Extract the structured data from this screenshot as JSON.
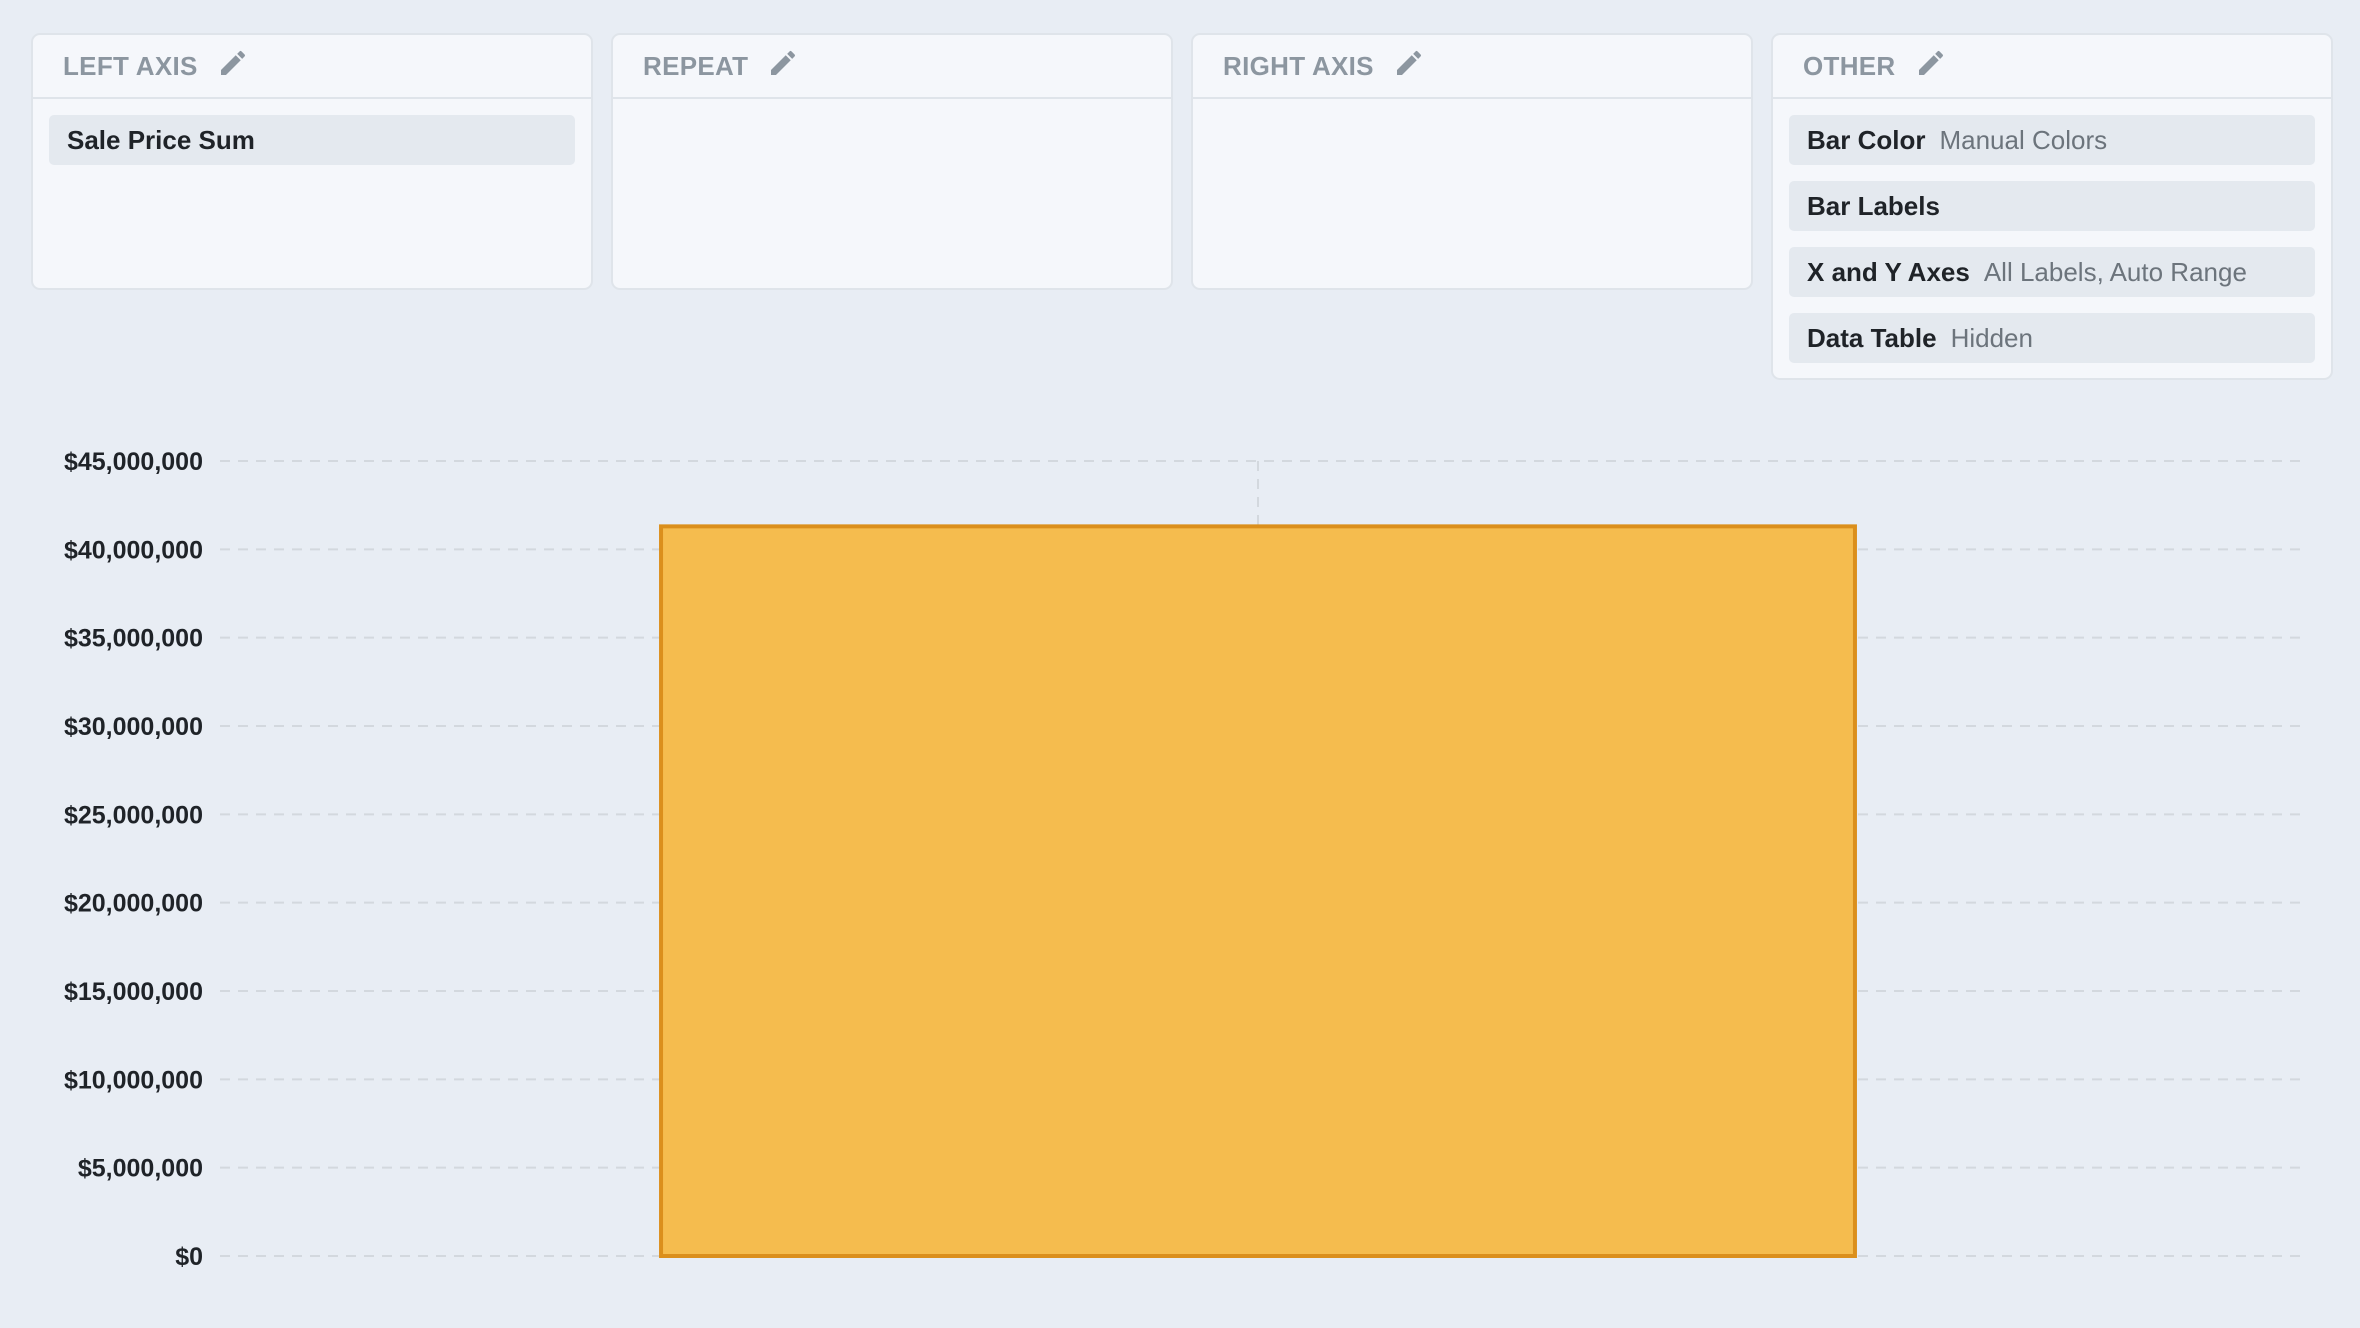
{
  "panels": {
    "left_axis": {
      "title": "LEFT AXIS",
      "items": [
        {
          "key": "Sale Price Sum",
          "value": ""
        }
      ]
    },
    "repeat": {
      "title": "REPEAT",
      "items": []
    },
    "right_axis": {
      "title": "RIGHT AXIS",
      "items": []
    },
    "other": {
      "title": "OTHER",
      "items": [
        {
          "key": "Bar Color",
          "value": "Manual Colors"
        },
        {
          "key": "Bar Labels",
          "value": ""
        },
        {
          "key": "X and Y Axes",
          "value": "All Labels, Auto Range"
        },
        {
          "key": "Data Table",
          "value": "Hidden"
        }
      ]
    }
  },
  "icons": {
    "edit": "pencil-icon"
  },
  "colors": {
    "bar_fill": "#f5bc4e",
    "bar_stroke": "#db8f1c",
    "grid": "#d3d8de",
    "background": "#e8edf4"
  },
  "chart_data": {
    "type": "bar",
    "categories": [
      ""
    ],
    "series": [
      {
        "name": "Sale Price Sum",
        "values": [
          41300000
        ]
      }
    ],
    "ylim": [
      0,
      45000000
    ],
    "yticks": [
      0,
      5000000,
      10000000,
      15000000,
      20000000,
      25000000,
      30000000,
      35000000,
      40000000,
      45000000
    ],
    "ytick_labels": [
      "$0",
      "$5,000,000",
      "$10,000,000",
      "$15,000,000",
      "$20,000,000",
      "$25,000,000",
      "$30,000,000",
      "$35,000,000",
      "$40,000,000",
      "$45,000,000"
    ],
    "grid": true,
    "title": "",
    "xlabel": "",
    "ylabel": ""
  }
}
